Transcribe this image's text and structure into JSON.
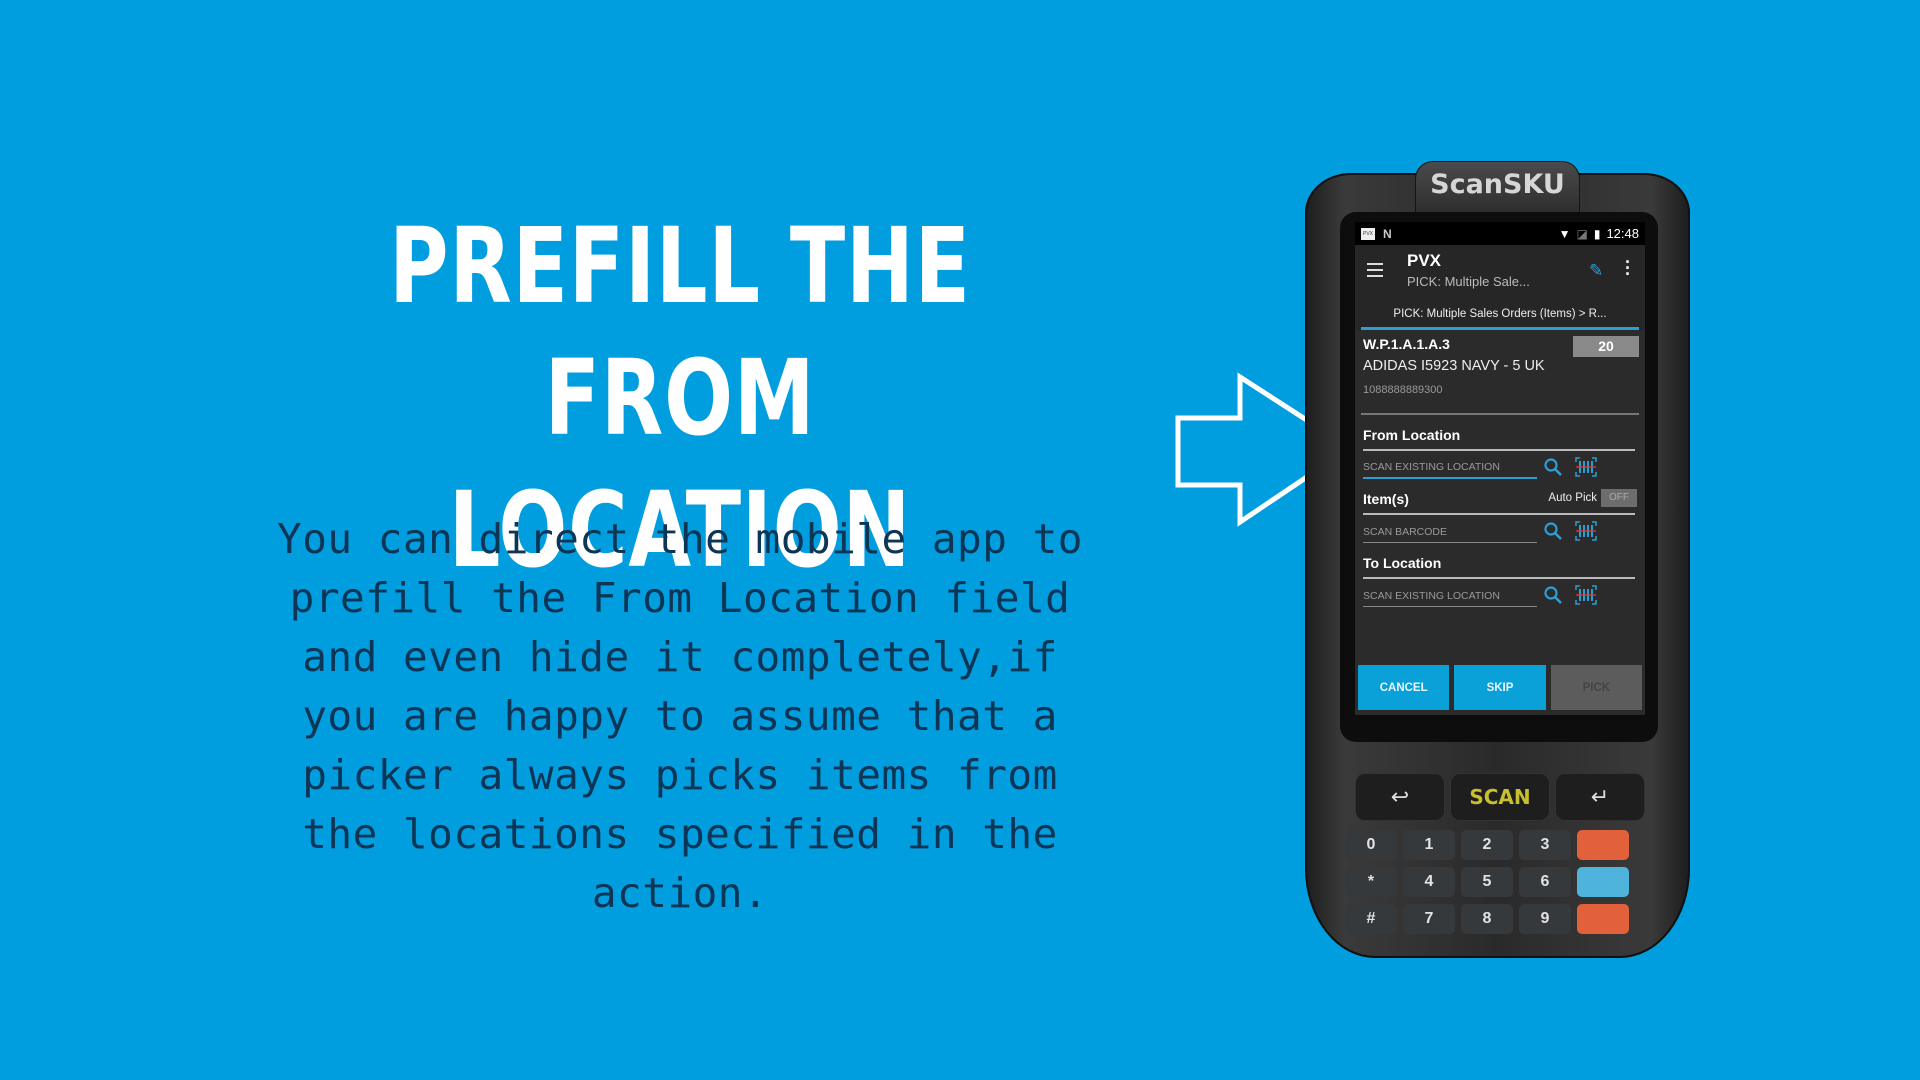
{
  "slide": {
    "headline_lines": [
      "PREFILL THE FROM",
      "LOCATION"
    ],
    "body_lines": [
      "You can direct the mobile app to",
      "prefill the From Location field",
      "and even hide it completely,if",
      "you are happy to assume that a",
      "picker always picks items from",
      "the locations specified in the",
      "action."
    ],
    "colors": {
      "background": "#019edf",
      "headline": "#ffffff",
      "body": "#0d3555"
    },
    "arrow_icon": "outline-arrow-right-icon"
  },
  "device": {
    "brand": "ScanSKU",
    "status_bar": {
      "app_badge": "PVX",
      "time": "12:48"
    },
    "toolbar": {
      "title": "PVX",
      "subtitle": "PICK: Multiple Sale...",
      "edit_icon": "pencil-icon",
      "menu_icon": "hamburger-icon",
      "more_icon": "more-vert-icon"
    },
    "breadcrumb": "PICK: Multiple Sales Orders (Items) > R...",
    "item": {
      "location_code": "W.P.1.A.1.A.3",
      "quantity": "20",
      "product_name": "ADIDAS I5923 NAVY - 5 UK",
      "barcode": "1088888889300"
    },
    "from_location": {
      "label": "From Location",
      "placeholder": "SCAN EXISTING LOCATION",
      "value": ""
    },
    "items": {
      "label": "Item(s)",
      "auto_pick_label": "Auto Pick",
      "auto_pick_state": "OFF",
      "placeholder": "SCAN BARCODE",
      "value": ""
    },
    "to_location": {
      "label": "To Location",
      "placeholder": "SCAN EXISTING LOCATION",
      "value": ""
    },
    "buttons": {
      "cancel": "CANCEL",
      "skip": "SKIP",
      "pick": "PICK"
    },
    "hardware_keys": {
      "scan": "SCAN",
      "back": "↩",
      "enter": "↵",
      "rows": [
        [
          "0",
          "1",
          "2",
          "3"
        ],
        [
          "*",
          "4",
          "5",
          "6"
        ],
        [
          "#",
          "7",
          "8",
          "9"
        ]
      ]
    },
    "accent_color": "#2a9fd6"
  }
}
